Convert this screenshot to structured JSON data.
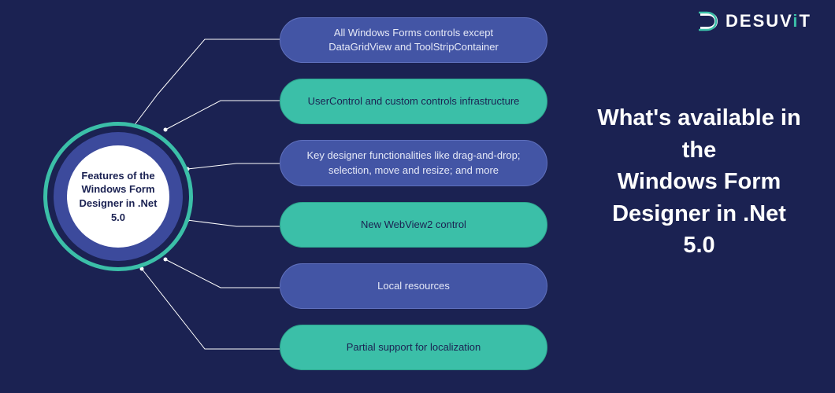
{
  "brand": {
    "name": "DESUViT"
  },
  "hub": {
    "title": "Features of the Windows Form Designer in .Net 5.0"
  },
  "features": [
    {
      "text": "All Windows Forms controls except DataGridView and ToolStripContainer",
      "variant": "blue"
    },
    {
      "text": "UserControl and custom controls infrastructure",
      "variant": "teal"
    },
    {
      "text": "Key designer functionalities like drag-and-drop; selection, move and resize; and more",
      "variant": "blue"
    },
    {
      "text": "New WebView2 control",
      "variant": "teal"
    },
    {
      "text": "Local resources",
      "variant": "blue"
    },
    {
      "text": "Partial support for localization",
      "variant": "teal"
    }
  ],
  "headline": {
    "line1": "What's available in the",
    "line2": "Windows Form Designer in .Net 5.0"
  },
  "colors": {
    "background": "#1b2252",
    "teal": "#3bbfa8",
    "blue": "#4355a5",
    "white": "#ffffff"
  }
}
